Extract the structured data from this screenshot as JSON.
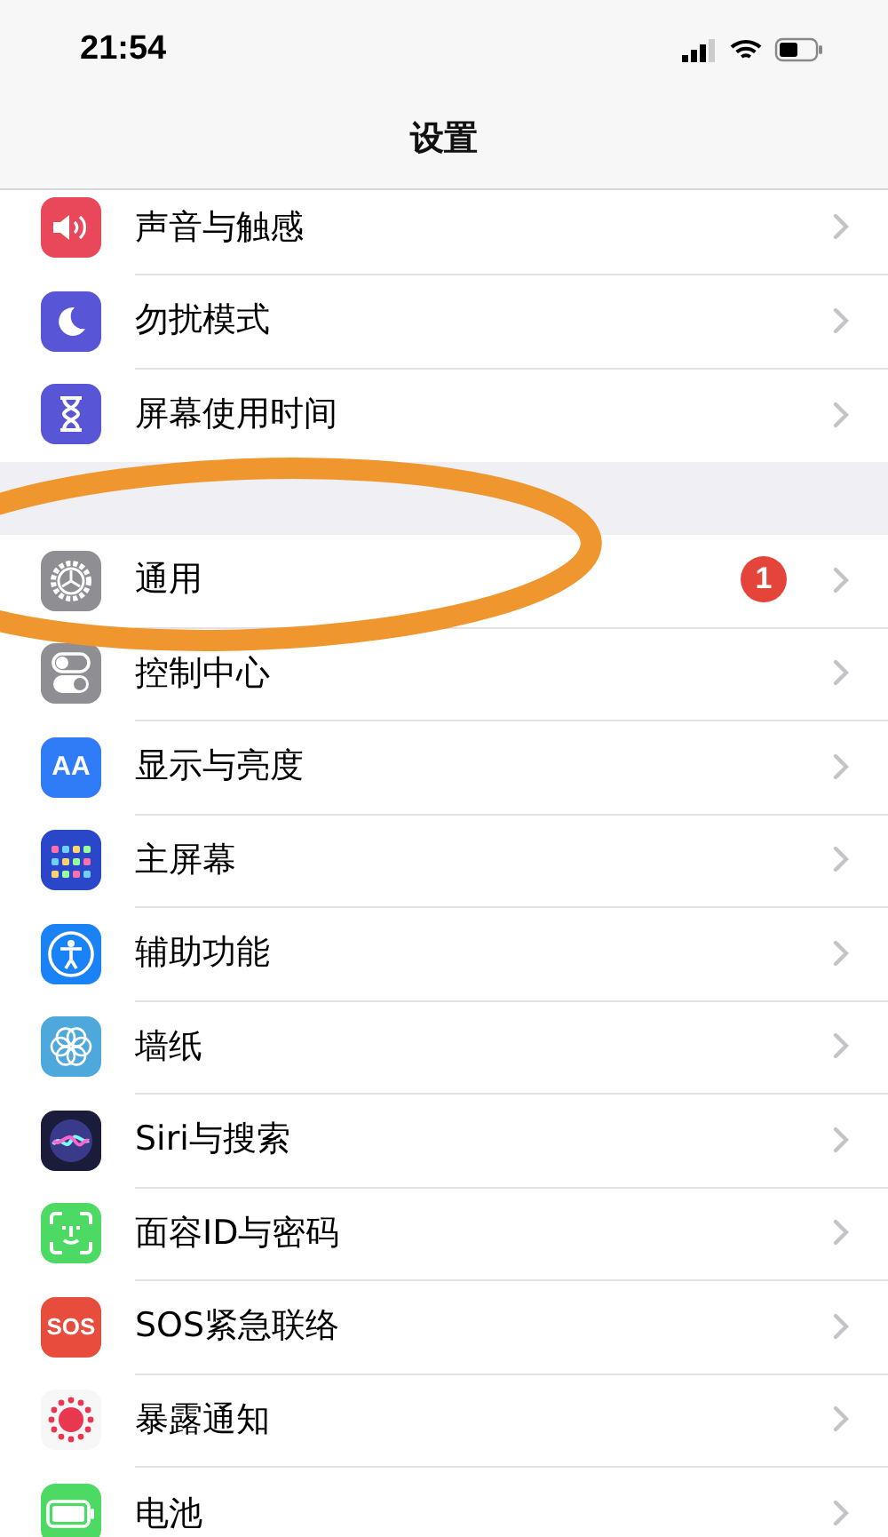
{
  "status_bar": {
    "time": "21:54"
  },
  "nav": {
    "title": "设置"
  },
  "sections": [
    {
      "rows": [
        {
          "kind": "sound",
          "label": "声音与触感"
        },
        {
          "kind": "moon",
          "label": "勿扰模式"
        },
        {
          "kind": "hourglass",
          "label": "屏幕使用时间"
        }
      ]
    },
    {
      "rows": [
        {
          "kind": "gear",
          "label": "通用",
          "badge": "1"
        },
        {
          "kind": "toggles",
          "label": "控制中心"
        },
        {
          "kind": "display",
          "label": "显示与亮度",
          "icon_label": "AA"
        },
        {
          "kind": "grid",
          "label": "主屏幕"
        },
        {
          "kind": "accessibility",
          "label": "辅助功能"
        },
        {
          "kind": "flower",
          "label": "墙纸"
        },
        {
          "kind": "siri",
          "label": "Siri与搜索"
        },
        {
          "kind": "face",
          "label": "面容ID与密码"
        },
        {
          "kind": "sos",
          "label": "SOS紧急联络",
          "icon_label": "SOS"
        },
        {
          "kind": "exposure",
          "label": "暴露通知"
        },
        {
          "kind": "battery",
          "label": "电池"
        }
      ]
    }
  ],
  "annotation": {
    "kind": "ellipse"
  }
}
